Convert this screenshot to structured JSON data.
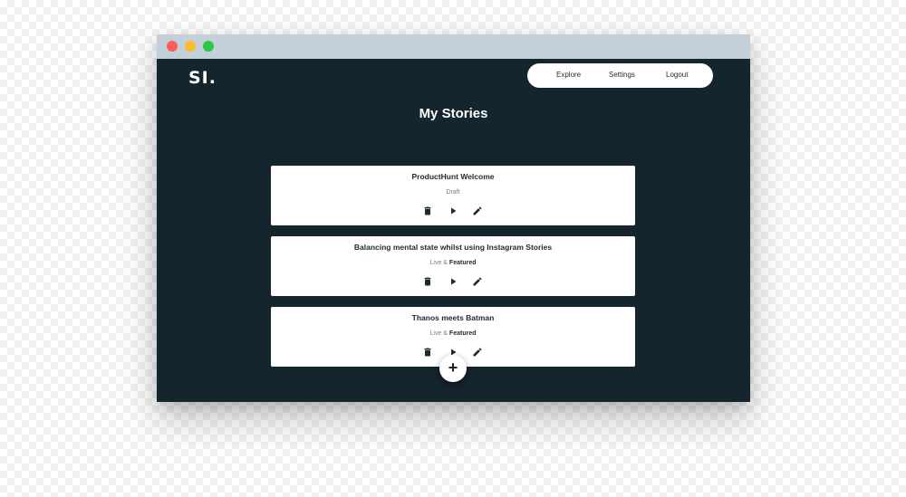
{
  "app": {
    "logo": "SI.",
    "nav": [
      {
        "label": "Explore"
      },
      {
        "label": "Settings"
      },
      {
        "label": "Logout"
      }
    ],
    "page_title": "My Stories"
  },
  "stories": [
    {
      "title": "ProductHunt Welcome",
      "status": "Draft",
      "featured": ""
    },
    {
      "title": "Balancing mental state whilst using Instagram Stories",
      "status": "Live & ",
      "featured": "Featured"
    },
    {
      "title": "Thanos meets Batman",
      "status": "Live & ",
      "featured": "Featured"
    }
  ],
  "actions": {
    "delete_icon": "trash-icon",
    "play_icon": "play-icon",
    "edit_icon": "pencil-icon"
  },
  "fab": {
    "label": "+"
  },
  "colors": {
    "app_background": "#15252d",
    "titlebar": "#c3cfd9",
    "card": "#ffffff",
    "close_dot": "#fc5f57",
    "minimize_dot": "#fdbc2e",
    "maximize_dot": "#28c840"
  }
}
